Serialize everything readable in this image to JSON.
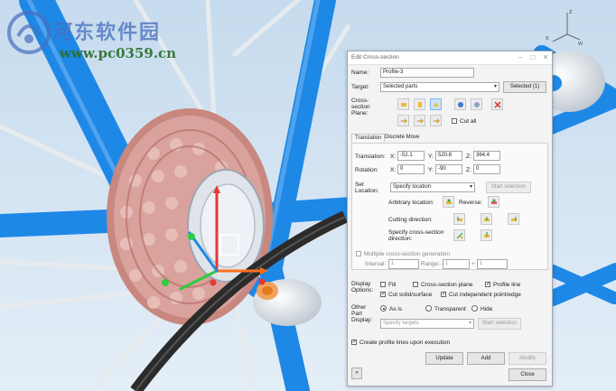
{
  "watermark": {
    "title": "河东软件园",
    "url": "www.pc0359.cn"
  },
  "viewport": {
    "axis_labels": {
      "z": "z",
      "x": "x",
      "w": "w"
    }
  },
  "dialog": {
    "title": "Edit Cross-section",
    "name_label": "Name:",
    "name_value": "Profile-3",
    "target_label": "Target:",
    "target_value": "Selected parts",
    "selected_button": "Selected (1)",
    "plane_label": "Cross-section Plane:",
    "cut_all_label": "Cut all",
    "tabs": [
      "Translation",
      "Discrete Move"
    ],
    "translation_label": "Translation:",
    "rotation_label": "Rotation:",
    "axes": [
      "X:",
      "Y:",
      "Z:"
    ],
    "translation_values": [
      "-52.1",
      "520.8",
      "364.4"
    ],
    "rotation_values": [
      "0",
      "-90",
      "0"
    ],
    "set_location_label": "Set Location:",
    "set_location_value": "Specify location",
    "start_selection_label": "Start selection",
    "arbitrary_location_label": "Arbitrary location:",
    "reverse_label": "Reverse:",
    "cutting_direction_label": "Cutting direction:",
    "specify_direction_label": "Specify cross-section direction:",
    "multiple_label": "Multiple cross-section generation",
    "interval_label": "Interval:",
    "interval_value": "1",
    "range_label": "Range: -",
    "range_min": "1",
    "range_plus": "+",
    "range_max": "1",
    "display_options_label": "Display Options:",
    "fill_label": "Fill",
    "plane_option_label": "Cross-section plane",
    "profile_line_label": "Profile line",
    "cut_solid_label": "Cut solid/surface",
    "cut_independent_label": "Cut independent point/edge",
    "other_part_label": "Other Part Display:",
    "as_is_label": "As is",
    "transparent_label": "Transparent",
    "hide_label": "Hide",
    "specify_targets_value": "Specify targets",
    "start_selection2_label": "Start selection",
    "create_profile_label": "Create profile lines upon execution",
    "update_label": "Update",
    "add_label": "Add",
    "modify_label": "Modify",
    "close_label": "Close",
    "collapse_label": "»"
  },
  "colors": {
    "frame_blue": "#1e88e6",
    "cassette": "#d9a29c",
    "bg": "#cfe0ef",
    "dialog_bg": "#f3f3f3"
  }
}
